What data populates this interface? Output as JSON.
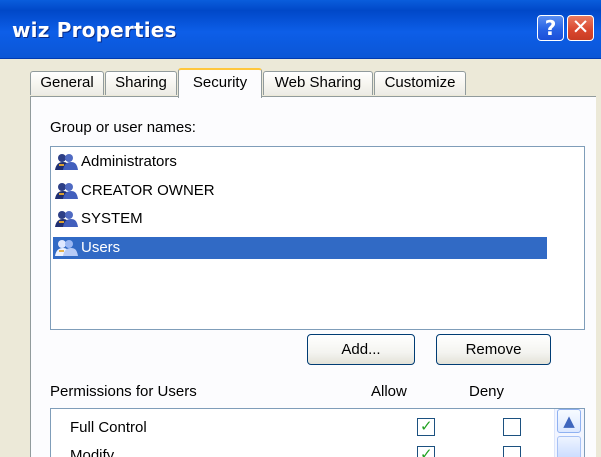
{
  "window": {
    "title": "wiz Properties",
    "help_label": "?",
    "close_label": "✕"
  },
  "tabs": [
    {
      "label": "General",
      "active": false
    },
    {
      "label": "Sharing",
      "active": false
    },
    {
      "label": "Security",
      "active": true
    },
    {
      "label": "Web Sharing",
      "active": false
    },
    {
      "label": "Customize",
      "active": false
    }
  ],
  "security": {
    "group_label": "Group or user names:",
    "users": [
      {
        "label": "Administrators",
        "icon": "user-group-icon",
        "selected": false
      },
      {
        "label": "CREATOR OWNER",
        "icon": "user-group-icon",
        "selected": false
      },
      {
        "label": "SYSTEM",
        "icon": "user-group-icon",
        "selected": false
      },
      {
        "label": "Users",
        "icon": "user-group-icon",
        "selected": true
      }
    ],
    "buttons": {
      "add_label": "Add...",
      "remove_label": "Remove"
    },
    "permissions_label": "Permissions for Users",
    "allow_label": "Allow",
    "deny_label": "Deny",
    "permissions": [
      {
        "label": "Full Control",
        "allow": true,
        "deny": false
      },
      {
        "label": "Modify",
        "allow": true,
        "deny": false
      }
    ]
  },
  "scrollbar": {
    "up_icon": "▲"
  },
  "colors": {
    "title_blue": "#0b56d6",
    "selection_blue": "#316ac5",
    "active_tab_accent": "#ffc73c",
    "checkmark_green": "#21a121"
  }
}
